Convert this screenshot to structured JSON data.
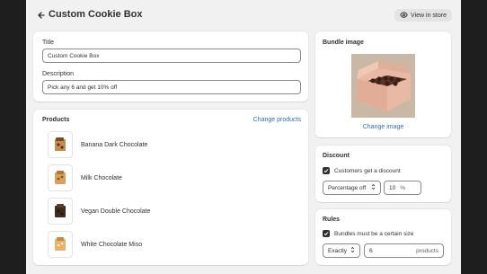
{
  "header": {
    "title": "Custom Cookie Box",
    "view_store_label": "View in store"
  },
  "details": {
    "title_label": "Title",
    "title_value": "Custom Cookie Box",
    "description_label": "Description",
    "description_value": "Pick any 6 and get 10% off"
  },
  "products": {
    "heading": "Products",
    "change_label": "Change products",
    "items": [
      {
        "name": "Banana Dark Chocolate"
      },
      {
        "name": "Milk Chocolate"
      },
      {
        "name": "Vegan Double Chocolate"
      },
      {
        "name": "White Chocolate Miso"
      }
    ]
  },
  "bundle_image": {
    "heading": "Bundle image",
    "change_label": "Change image"
  },
  "discount": {
    "heading": "Discount",
    "checkbox_label": "Customers get a discount",
    "checked": true,
    "type_value": "Percentage off",
    "amount_value": "10",
    "amount_suffix": "%"
  },
  "rules": {
    "heading": "Rules",
    "checkbox_label": "Bundles must be a certain size",
    "checked": true,
    "mode_value": "Exactly",
    "count_value": "6",
    "count_suffix": "products"
  },
  "colors": {
    "frame_bg": "#f1f1f1",
    "outer_bg": "#1e1e1e",
    "link": "#2c6ecb",
    "text": "#303030",
    "card_bg": "#ffffff"
  }
}
